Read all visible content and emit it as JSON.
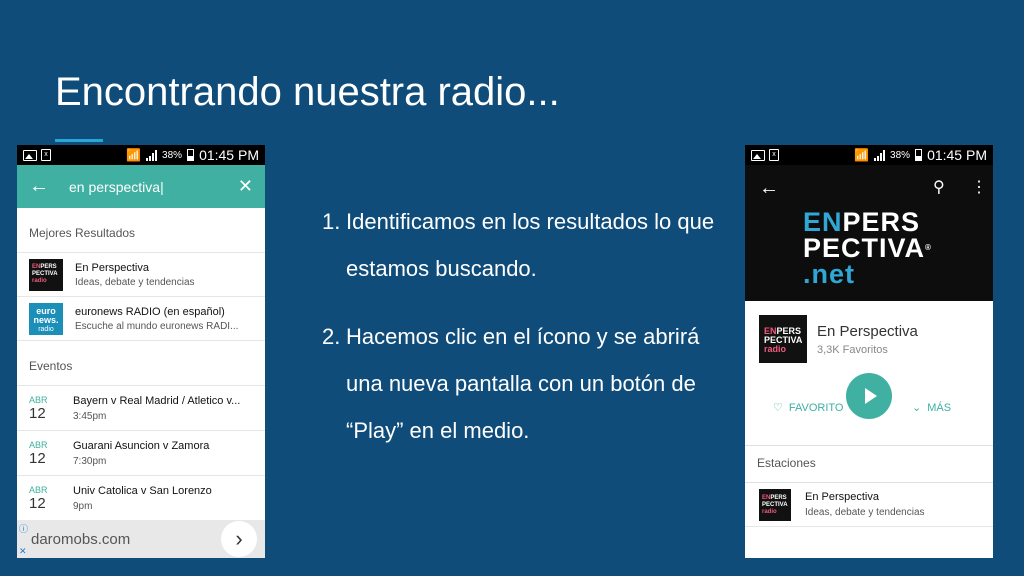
{
  "slide": {
    "title": "Encontrando nuestra radio...",
    "steps": [
      {
        "num": "1.",
        "text": "Identificamos en los resultados lo que estamos buscando."
      },
      {
        "num": "2.",
        "text": " Hacemos clic en el ícono y se abrirá una nueva pantalla con un botón de “Play” en el medio."
      }
    ]
  },
  "status_bar": {
    "battery": "38%",
    "time": "01:45 PM"
  },
  "search_screen": {
    "query": "en perspectiva",
    "best_results_label": "Mejores Resultados",
    "results": [
      {
        "title": "En Perspectiva",
        "subtitle": "Ideas, debate y tendencias",
        "thumb_line1": "EN PERS",
        "thumb_line2": "PECTIVA",
        "thumb_line3": "radio"
      },
      {
        "title": "euronews RADIO (en español)",
        "subtitle": "Escuche al mundo euronews RADI...",
        "thumb_line1": "euro",
        "thumb_line2": "news.",
        "thumb_line3": "radio"
      }
    ],
    "events_label": "Eventos",
    "events": [
      {
        "month": "ABR",
        "day": "12",
        "title": "Bayern v Real Madrid / Atletico v...",
        "time": "3:45pm"
      },
      {
        "month": "ABR",
        "day": "12",
        "title": "Guarani Asuncion v Zamora",
        "time": "7:30pm"
      },
      {
        "month": "ABR",
        "day": "12",
        "title": "Univ Catolica v San Lorenzo",
        "time": "9pm"
      }
    ],
    "ad": {
      "text": "daromobs.com",
      "info": "ⓘ",
      "close": "✕"
    }
  },
  "station_screen": {
    "logo": {
      "en": "EN",
      "pers": "PERS",
      "pectiva": "PECTIVA",
      "reg": "®",
      "net": ".net"
    },
    "station_name": "En Perspectiva",
    "favorites": "3,3K Favoritos",
    "thumb": {
      "line1": "EN PERS",
      "line2": "PECTIVA",
      "line3": "radio"
    },
    "favorite_label": "FAVORITO",
    "more_label": "MÁS",
    "stations_label": "Estaciones",
    "stations": [
      {
        "title": "En Perspectiva",
        "subtitle": "Ideas, debate y tendencias",
        "thumb_line1": "EN PERS",
        "thumb_line2": "PECTIVA",
        "thumb_line3": "radio"
      }
    ]
  },
  "colors": {
    "background": "#0f4c7a",
    "accent_teal": "#3fb0a2",
    "brand_blue": "#2fa8d6",
    "brand_pink": "#f05a7e"
  },
  "icons": [
    "back-arrow-icon",
    "close-icon",
    "search-icon",
    "more-vert-icon",
    "play-icon",
    "heart-icon",
    "chevron-down-icon",
    "chevron-right-icon",
    "wifi-icon",
    "signal-icon",
    "battery-icon",
    "image-icon",
    "sim-icon"
  ]
}
